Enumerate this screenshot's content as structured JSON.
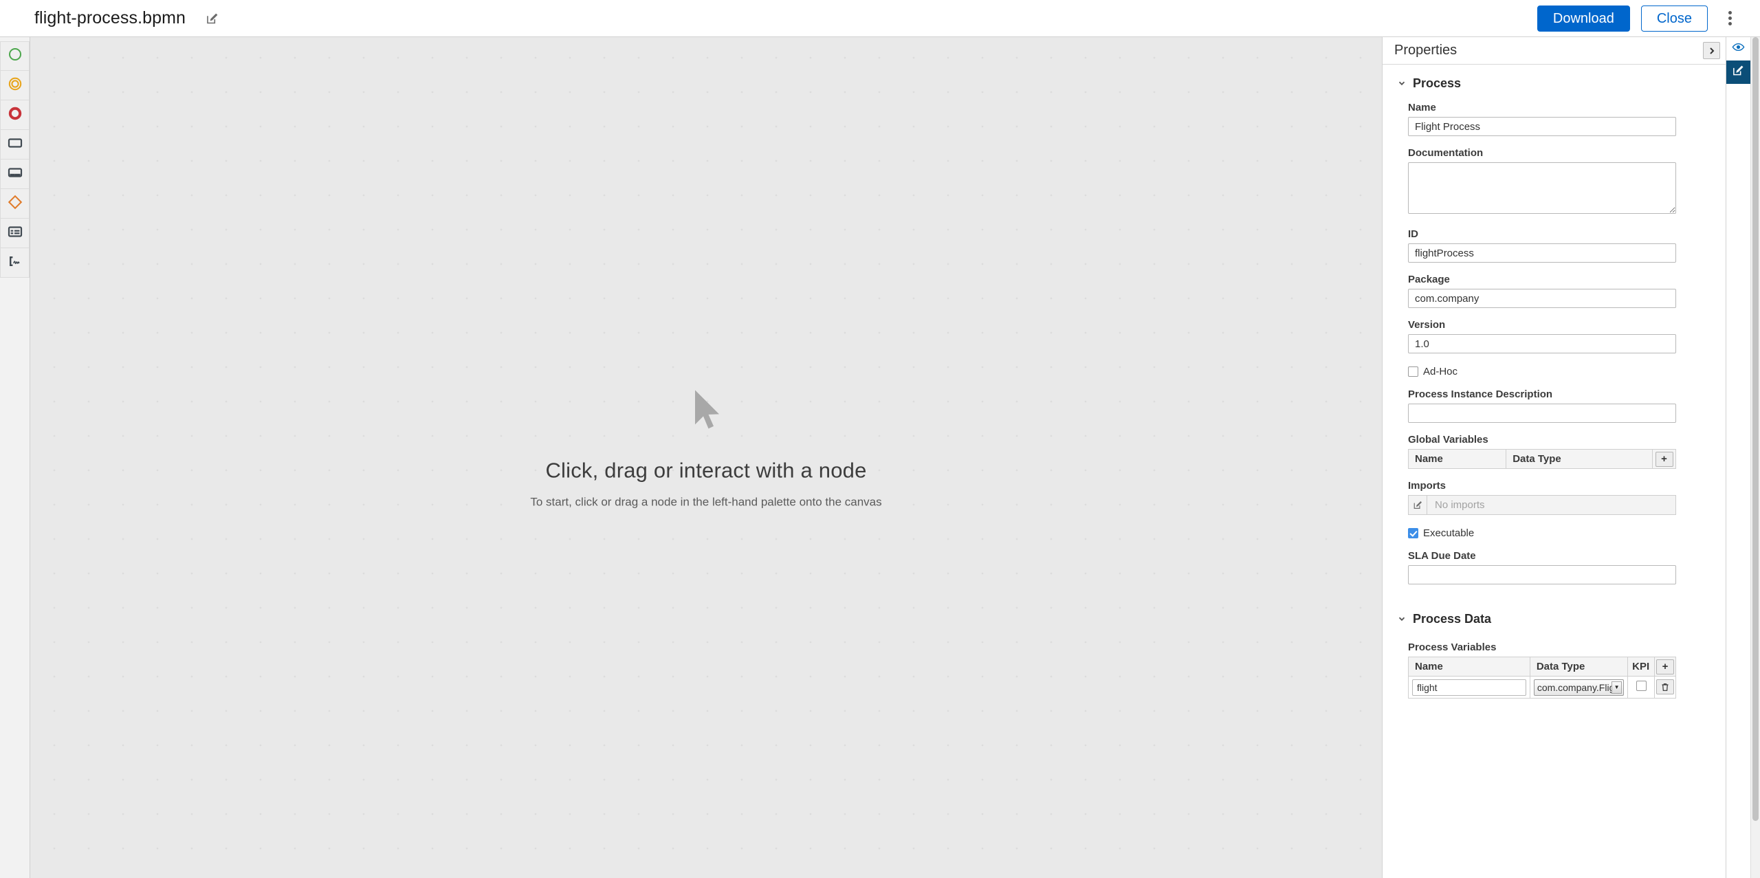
{
  "topbar": {
    "document_title": "flight-process.bpmn",
    "edit_icon": "edit-pencil-icon",
    "download_label": "Download",
    "close_label": "Close",
    "kebab_icon": "more-vertical-icon"
  },
  "palette": {
    "items": [
      {
        "name": "start-event",
        "icon": "green-circle-icon"
      },
      {
        "name": "intermediate-event",
        "icon": "orange-double-circle-icon"
      },
      {
        "name": "end-event",
        "icon": "red-circle-icon"
      },
      {
        "name": "task",
        "icon": "rectangle-icon"
      },
      {
        "name": "subprocess",
        "icon": "subprocess-icon"
      },
      {
        "name": "gateway",
        "icon": "orange-diamond-icon"
      },
      {
        "name": "data-object",
        "icon": "table-form-icon"
      },
      {
        "name": "annotation",
        "icon": "signature-icon"
      }
    ]
  },
  "canvas": {
    "cursor_icon": "mouse-pointer-icon",
    "empty_title": "Click, drag or interact with a node",
    "empty_subtitle": "To start, click or drag a node in the left-hand palette onto the canvas"
  },
  "properties": {
    "title": "Properties",
    "collapse_icon": "chevron-right-icon",
    "sections": {
      "process": {
        "title": "Process",
        "chevron": "chevron-down-icon",
        "name": {
          "label": "Name",
          "value": "Flight Process"
        },
        "documentation": {
          "label": "Documentation",
          "value": ""
        },
        "id": {
          "label": "ID",
          "value": "flightProcess"
        },
        "package": {
          "label": "Package",
          "value": "com.company"
        },
        "version": {
          "label": "Version",
          "value": "1.0"
        },
        "adhoc": {
          "label": "Ad-Hoc",
          "checked": false
        },
        "instance_description": {
          "label": "Process Instance Description",
          "value": ""
        },
        "global_variables": {
          "label": "Global Variables",
          "columns": [
            "Name",
            "Data Type"
          ],
          "add_label": "+",
          "rows": []
        },
        "imports": {
          "label": "Imports",
          "edit_icon": "edit-pencil-icon",
          "placeholder": "No imports"
        },
        "executable": {
          "label": "Executable",
          "checked": true
        },
        "sla_due_date": {
          "label": "SLA Due Date",
          "value": ""
        }
      },
      "process_data": {
        "title": "Process Data",
        "chevron": "chevron-down-icon",
        "process_variables": {
          "label": "Process Variables",
          "columns": [
            "Name",
            "Data Type",
            "KPI"
          ],
          "add_label": "+",
          "rows": [
            {
              "name": "flight",
              "data_type": "com.company.Flight",
              "kpi": false,
              "delete_icon": "trash-icon"
            }
          ]
        }
      }
    }
  },
  "rail": {
    "items": [
      {
        "name": "preview-eye",
        "icon": "eye-icon",
        "active": false
      },
      {
        "name": "edit-properties",
        "icon": "edit-pencil-icon",
        "active": true
      }
    ]
  },
  "colors": {
    "accent_blue": "#0066cc",
    "checkbox_blue": "#3c8ee8",
    "rail_active": "#0b4e78",
    "canvas_bg": "#e9e9e9",
    "start_green": "#4ca64c",
    "intermediate_orange": "#e8a317",
    "end_red": "#c8333a",
    "gateway_orange": "#e07b2a"
  }
}
